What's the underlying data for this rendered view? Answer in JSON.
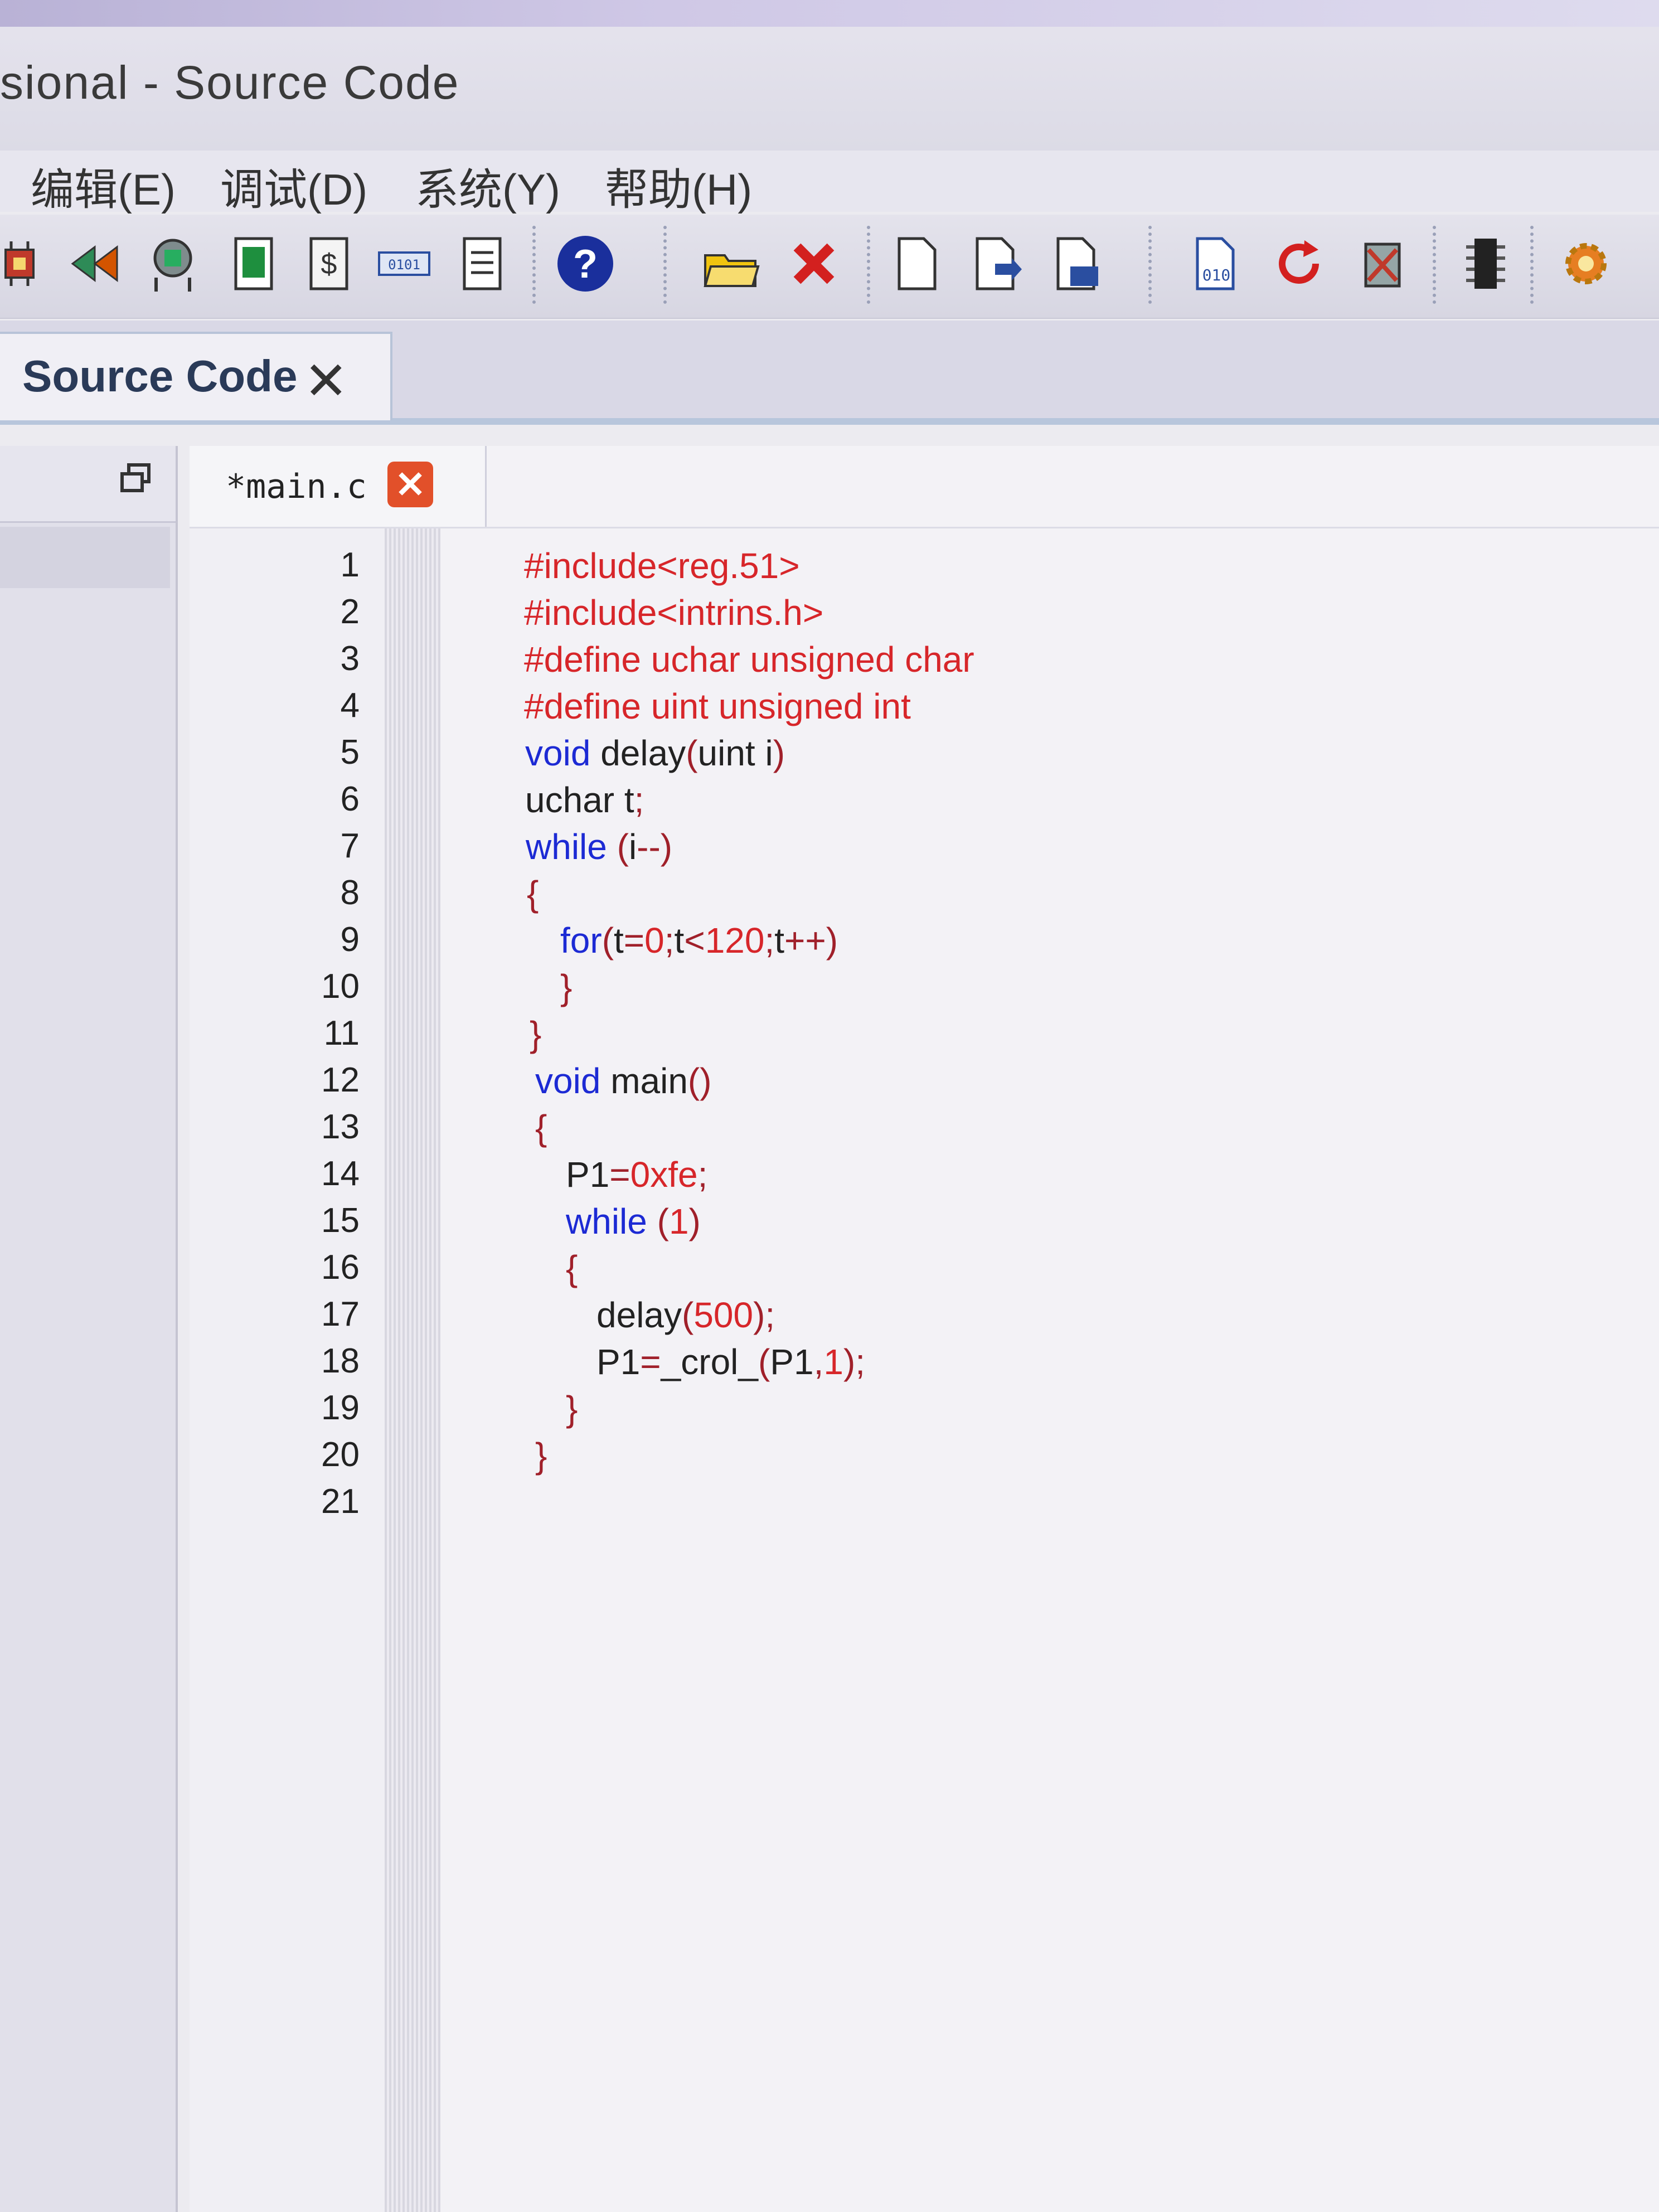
{
  "window": {
    "title": "sional - Source Code"
  },
  "menu": [
    "编辑(E)",
    "调试(D)",
    "系统(Y)",
    "帮助(H)"
  ],
  "toolbar": {
    "icons": [
      "chip-icon",
      "rewind-icon",
      "component-icon",
      "device-icon",
      "dollar-doc-icon",
      "binary-display-icon",
      "document-list-icon",
      "help-icon",
      "open-folder-icon",
      "delete-icon",
      "new-file-icon",
      "import-file-icon",
      "export-file-icon",
      "binary-file-icon",
      "refresh-icon",
      "compile-icon",
      "ic-chip-icon",
      "gear-icon"
    ]
  },
  "doc_tab": {
    "label": "Source Code",
    "close": "✕"
  },
  "file_tab": {
    "label": "*main.c",
    "close": "✕"
  },
  "code": {
    "line_numbers": [
      "1",
      "2",
      "3",
      "4",
      "5",
      "6",
      "7",
      "8",
      "9",
      "10",
      "11",
      "12",
      "13",
      "14",
      "15",
      "16",
      "17",
      "18",
      "19",
      "20",
      "21"
    ],
    "lines": [
      "#include<reg.51>",
      "#include<intrins.h>",
      "#define uchar unsigned char",
      "#define uint unsigned int",
      "void delay(uint i)",
      "uchar t;",
      "while (i--)",
      "{",
      "for(t=0;t<120;t++)",
      "}",
      "}",
      "void main()",
      "{",
      "P1=0xfe;",
      "while (1)",
      "{",
      "delay(500);",
      "P1=_crol_(P1,1);",
      "}",
      "}",
      ""
    ]
  }
}
